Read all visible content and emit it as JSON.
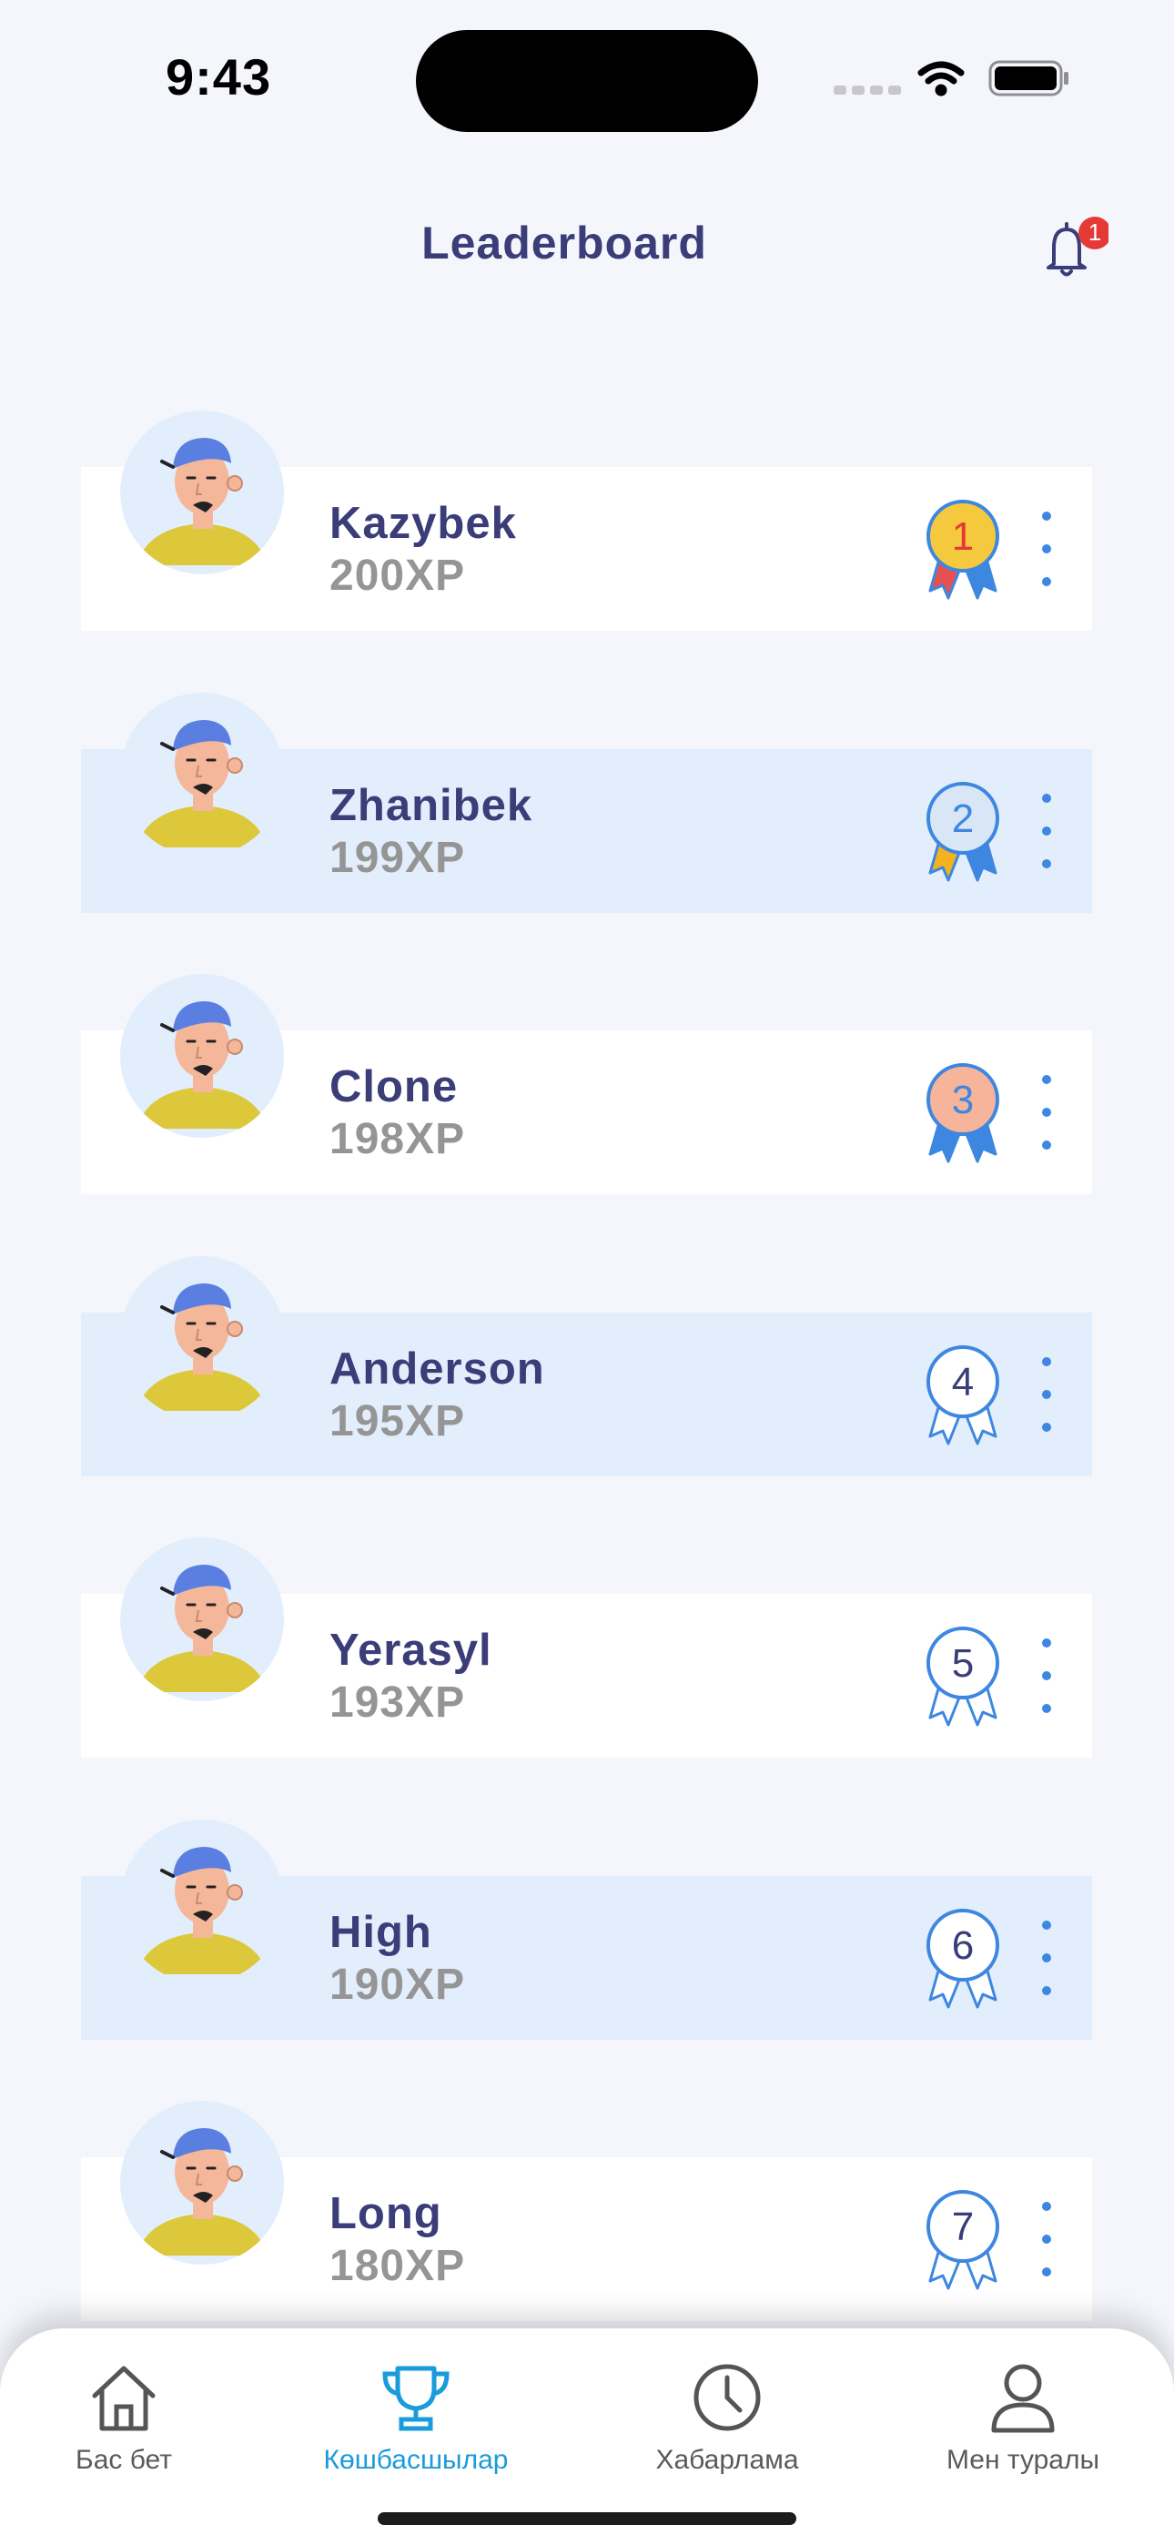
{
  "status_bar": {
    "time": "9:43"
  },
  "header": {
    "title": "Leaderboard",
    "notification_count": "1"
  },
  "leaderboard": [
    {
      "name": "Kazybek",
      "xp": "200XP",
      "rank": "1",
      "medal_style": "gold"
    },
    {
      "name": "Zhanibek",
      "xp": "199XP",
      "rank": "2",
      "medal_style": "silver"
    },
    {
      "name": "Clone",
      "xp": "198XP",
      "rank": "3",
      "medal_style": "bronze"
    },
    {
      "name": "Anderson",
      "xp": "195XP",
      "rank": "4",
      "medal_style": "outline"
    },
    {
      "name": "Yerasyl",
      "xp": "193XP",
      "rank": "5",
      "medal_style": "outline"
    },
    {
      "name": "High",
      "xp": "190XP",
      "rank": "6",
      "medal_style": "outline"
    },
    {
      "name": "Long",
      "xp": "180XP",
      "rank": "7",
      "medal_style": "outline"
    }
  ],
  "tabs": [
    {
      "label": "Бас бет",
      "icon": "home-icon",
      "active": false
    },
    {
      "label": "Көшбасшылар",
      "icon": "trophy-icon",
      "active": true
    },
    {
      "label": "Хабарлама",
      "icon": "clock-icon",
      "active": false
    },
    {
      "label": "Мен туралы",
      "icon": "profile-icon",
      "active": false
    }
  ],
  "colors": {
    "background": "#f4f6fc",
    "row_alt": "#e2eefc",
    "title": "#3a3d78",
    "xp": "#959595",
    "accent": "#1a9bdc",
    "badge": "#e53935",
    "medal_outline": "#3e87e0"
  }
}
